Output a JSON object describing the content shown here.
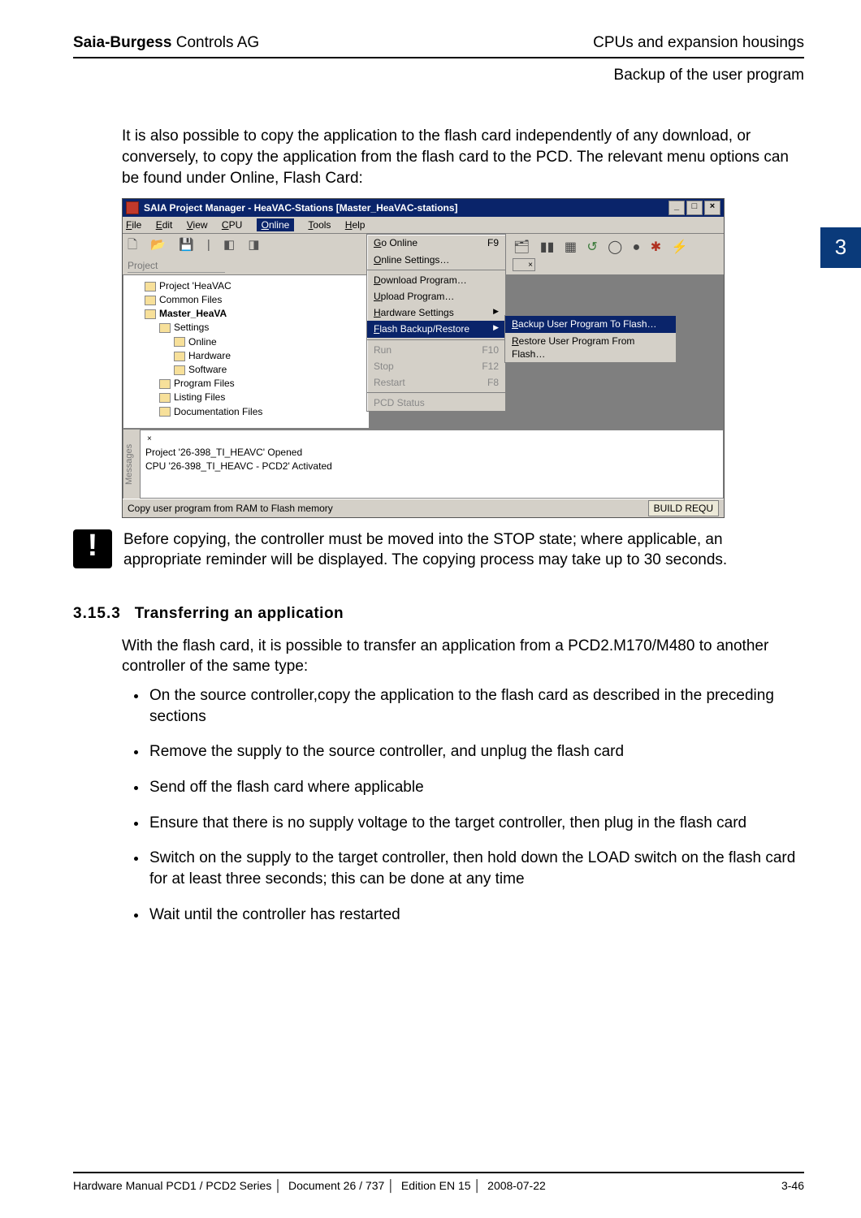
{
  "header": {
    "left_bold": "Saia-Burgess",
    "left_rest": " Controls AG",
    "right": "CPUs and expansion housings",
    "sub": "Backup of the user program"
  },
  "chapter_tab": "3",
  "intro_para": "It is also possible to copy the application to the flash card independently of any download, or conversely, to copy the application from the flash card to the PCD. The relevant menu options can be found under Online, Flash Card:",
  "shot": {
    "title": "SAIA Project Manager - HeaVAC-Stations [Master_HeaVAC-stations]",
    "win_buttons": {
      "min": "_",
      "max": "□",
      "close": "×"
    },
    "menubar": {
      "file": "File",
      "edit": "Edit",
      "view": "View",
      "cpu": "CPU",
      "online": "Online",
      "tools": "Tools",
      "help": "Help"
    },
    "project_label": "Project",
    "dropdown": {
      "go_online": "Go Online",
      "go_online_key": "F9",
      "online_settings": "Online Settings…",
      "download": "Download Program…",
      "upload": "Upload Program…",
      "hw_settings": "Hardware Settings",
      "flash_backup": "Flash Backup/Restore",
      "run": "Run",
      "run_key": "F10",
      "stop": "Stop",
      "stop_key": "F12",
      "restart": "Restart",
      "restart_key": "F8",
      "pcd_status": "PCD Status"
    },
    "submenu": {
      "backup": "Backup User Program To Flash…",
      "restore": "Restore User Program From Flash…"
    },
    "tree": {
      "n0": "Project 'HeaVAC",
      "n1": "Common Files",
      "n2": "Master_HeaVA",
      "n3": "Settings",
      "n4": "Online",
      "n5": "Hardware",
      "n6": "Software",
      "n7": "Program Files",
      "n8": "Listing Files",
      "n9": "Documentation Files"
    },
    "messages_tab": "Messages",
    "messages": {
      "l1": "Project '26-398_TI_HEAVC' Opened",
      "l2": "CPU '26-398_TI_HEAVC - PCD2' Activated"
    },
    "statusbar": {
      "left": "Copy user program from RAM to Flash memory",
      "right": "BUILD REQU"
    },
    "panel_close_mini": "×"
  },
  "warning": "Before copying, the controller must be moved into the STOP state; where applicable, an appropriate reminder will be displayed. The copying process may take up to 30 seconds.",
  "section": {
    "number": "3.15.3",
    "title": "Transferring an application",
    "lead": "With the flash card, it is possible to transfer an application from a PCD2.M170/M480 to another controller of the same type:",
    "bullets": [
      "On the source controller,copy the application to the flash card as described in the preceding sections",
      "Remove the supply to the source controller, and unplug the flash card",
      "Send off the flash card where applicable",
      "Ensure that there is no supply voltage to the target controller, then plug in the flash card",
      "Switch on the supply to the target controller, then hold down the LOAD switch on the flash card for at least three seconds; this can be done at any time",
      "Wait until the controller has restarted"
    ]
  },
  "footer": {
    "parts": [
      "Hardware Manual PCD1 / PCD2 Series",
      "Document 26 / 737",
      "Edition EN 15",
      "2008-07-22"
    ],
    "page": "3-46"
  }
}
